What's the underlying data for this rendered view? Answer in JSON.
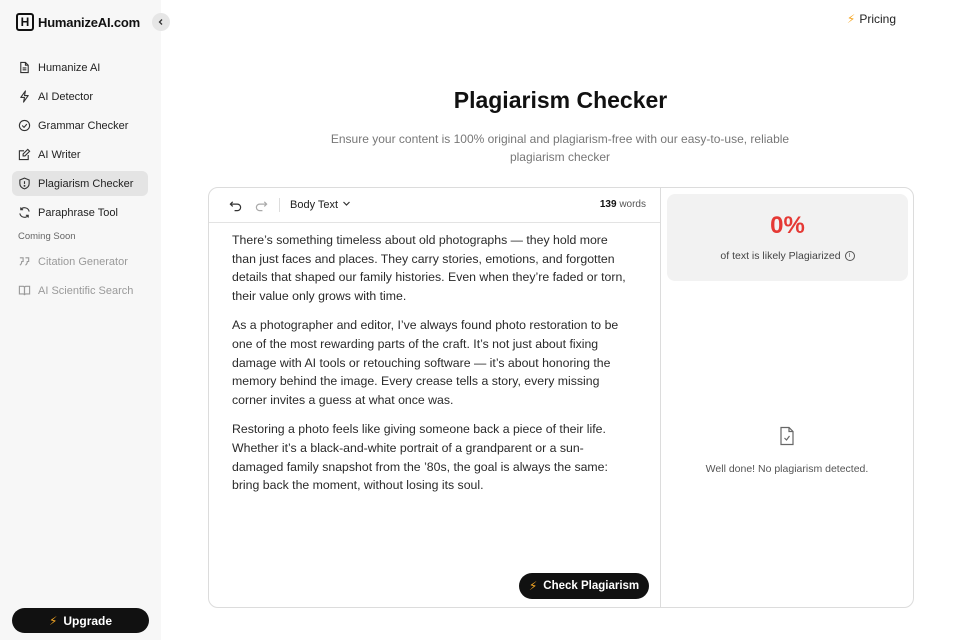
{
  "brand": {
    "name": "HumanizeAI.com",
    "mark": "H"
  },
  "sidebar": {
    "items": [
      {
        "label": "Humanize AI",
        "icon": "document-icon"
      },
      {
        "label": "AI Detector",
        "icon": "bolt-icon"
      },
      {
        "label": "Grammar Checker",
        "icon": "check-circle-icon"
      },
      {
        "label": "AI Writer",
        "icon": "edit-icon"
      },
      {
        "label": "Plagiarism Checker",
        "icon": "shield-icon",
        "active": true
      },
      {
        "label": "Paraphrase Tool",
        "icon": "refresh-icon"
      }
    ],
    "coming_soon_label": "Coming Soon",
    "coming_soon_items": [
      {
        "label": "Citation Generator",
        "icon": "quote-icon"
      },
      {
        "label": "AI Scientific Search",
        "icon": "book-icon"
      }
    ],
    "upgrade_label": "Upgrade"
  },
  "header": {
    "pricing_label": "Pricing"
  },
  "page": {
    "title": "Plagiarism Checker",
    "subtitle": "Ensure your content is 100% original and plagiarism-free with our easy-to-use, reliable plagiarism checker"
  },
  "editor": {
    "style_select": "Body Text",
    "word_count": "139",
    "word_count_unit": "words",
    "paragraphs": [
      "There’s something timeless about old photographs — they hold more than just faces and places. They carry stories, emotions, and forgotten details that shaped our family histories. Even when they’re faded or torn, their value only grows with time.",
      "As a photographer and editor, I’ve always found photo restoration to be one of the most rewarding parts of the craft. It’s not just about fixing damage with AI tools or retouching software — it’s about honoring the memory behind the image. Every crease tells a story, every missing corner invites a guess at what once was.",
      "Restoring a photo feels like giving someone back a piece of their life. Whether it’s a black-and-white portrait of a grandparent or a sun-damaged family snapshot from the ’80s, the goal is always the same: bring back the moment, without losing its soul."
    ],
    "check_button": "Check Plagiarism"
  },
  "results": {
    "score": "0%",
    "score_label": "of text is likely Plagiarized",
    "empty_message": "Well done! No plagiarism detected."
  },
  "colors": {
    "accent_bolt": "#f5a623",
    "score_red": "#e53935",
    "button_dark": "#111111"
  }
}
